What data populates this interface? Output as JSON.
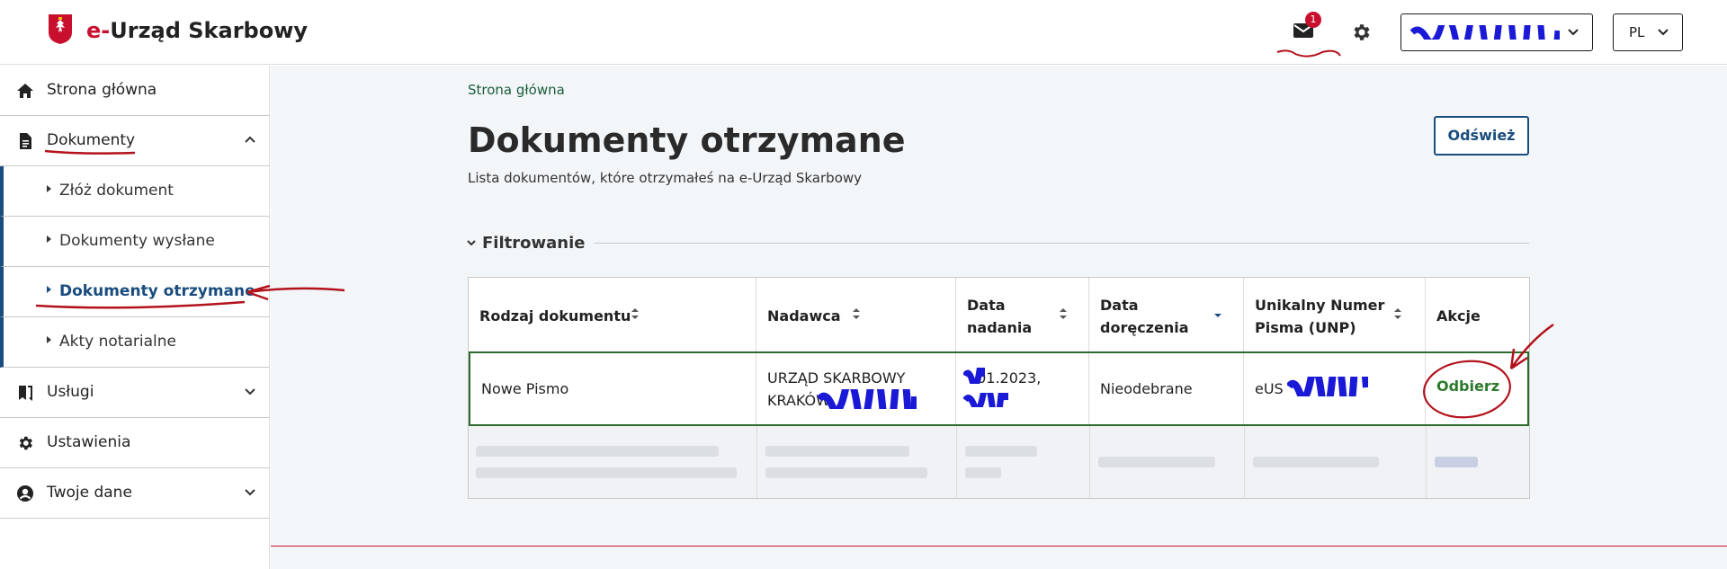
{
  "header": {
    "brand_prefix": "e-",
    "brand_rest": "Urząd Skarbowy",
    "mail_badge": "1",
    "account_label": "",
    "lang": "PL"
  },
  "sidebar": {
    "items": [
      {
        "label": "Strona główna",
        "icon": "home-icon"
      },
      {
        "label": "Dokumenty",
        "icon": "document-icon"
      },
      {
        "label": "Złóż dokument"
      },
      {
        "label": "Dokumenty wysłane"
      },
      {
        "label": "Dokumenty otrzymane"
      },
      {
        "label": "Akty notarialne"
      },
      {
        "label": "Usługi",
        "icon": "bookmark-icon"
      },
      {
        "label": "Ustawienia",
        "icon": "gear-icon"
      },
      {
        "label": "Twoje dane",
        "icon": "user-icon"
      }
    ]
  },
  "main": {
    "breadcrumb": "Strona główna",
    "title": "Dokumenty otrzymane",
    "subtitle": "Lista dokumentów, które otrzymałeś na e-Urząd Skarbowy",
    "refresh_label": "Odśwież",
    "filter_label": "Filtrowanie"
  },
  "table": {
    "headers": {
      "type": "Rodzaj dokumentu",
      "sender": "Nadawca",
      "date_sent_1": "Data",
      "date_sent_2": "nadania",
      "date_delivered_1": "Data",
      "date_delivered_2": "doręczenia",
      "unp_1": "Unikalny Numer",
      "unp_2": "Pisma (UNP)",
      "actions": "Akcje"
    },
    "row": {
      "type": "Nowe Pismo",
      "sender_1": "URZĄD SKARBOWY",
      "sender_2": "KRAKÓW",
      "date_sent_1": ".01.2023,",
      "status": "Nieodebrane",
      "unp": "eUS",
      "action": "Odbierz"
    }
  },
  "colors": {
    "brand_red": "#c8102e",
    "nav_blue": "#1a4d7e",
    "link_green": "#1a5c3a",
    "action_green": "#2d7a2d",
    "annotation_red": "#b3121c",
    "redaction_blue": "#1a1ad6"
  }
}
